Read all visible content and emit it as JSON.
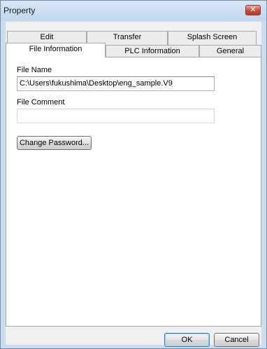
{
  "window": {
    "title": "Property",
    "close_glyph": "✕"
  },
  "tabs": {
    "row_back": [
      "Edit",
      "Transfer",
      "Splash Screen"
    ],
    "row_front": [
      "File Information",
      "PLC Information",
      "General"
    ],
    "active": "File Information"
  },
  "file_info": {
    "file_name_label": "File Name",
    "file_name_value": "C:\\Users\\fukushima\\Desktop\\eng_sample.V9",
    "file_comment_label": "File Comment",
    "file_comment_value": "",
    "change_password_label": "Change Password..."
  },
  "footer": {
    "ok_label": "OK",
    "cancel_label": "Cancel"
  },
  "colors": {
    "title_bar": "#c9dcf0",
    "close_button": "#c9493a",
    "panel_background": "#ffffff",
    "dialog_background": "#f0f0f0"
  }
}
